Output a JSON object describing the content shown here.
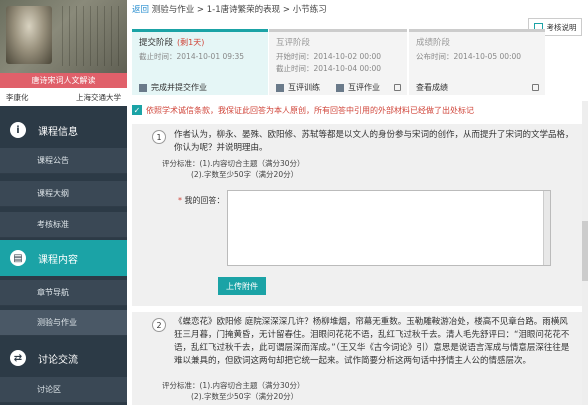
{
  "sidebar": {
    "course_title": "唐诗宋词人文解读",
    "teacher": "李康化",
    "university": "上海交通大学",
    "sections": [
      {
        "label": "课程信息",
        "icon": "info-icon"
      },
      {
        "label": "课程内容",
        "icon": "book-icon"
      },
      {
        "label": "讨论交流",
        "icon": "exchange-icon"
      }
    ],
    "items": [
      {
        "label": "课程公告"
      },
      {
        "label": "课程大纲"
      },
      {
        "label": "考核标准"
      },
      {
        "label": "章节导航"
      },
      {
        "label": "测验与作业"
      },
      {
        "label": "讨论区"
      }
    ]
  },
  "breadcrumb": {
    "back": "返回",
    "path": "测验与作业",
    "sep1": " >",
    "lesson": "1-1唐诗繁荣的表现",
    "sep2": " >",
    "current": "小节练习"
  },
  "guide": {
    "label": "考核说明",
    "icon": "document-icon"
  },
  "stages": [
    {
      "name": "提交阶段",
      "badge": "(剩1天)",
      "time1": "截止时间：2014-10-01 09:35",
      "time2": "",
      "action": "完成并提交作业"
    },
    {
      "name": "互评阶段",
      "badge": "",
      "time1": "开始时间：2014-10-02 00:00",
      "time2": "截止时间：2014-10-04 00:00",
      "action_a": "互评训练",
      "action_b": "互评作业"
    },
    {
      "name": "成绩阶段",
      "badge": "",
      "time1": "公布时间：2014-10-05 00:00",
      "time2": "",
      "action": "查看成绩"
    }
  ],
  "notice": "依照学术诚信条款，我保证此回答为本人原创，所有回答中引用的外部材料已经做了出处标记",
  "questions": [
    {
      "num": "1",
      "text": "作者认为，柳永、晏殊、欧阳修、苏轼等都是以文人的身份参与宋词的创作，从而提升了宋词的文学品格，你认为呢？并说明理由。",
      "criteria_label": "评分标准：",
      "criteria_1": "(1).内容切合主题（满分30分）",
      "criteria_2": "(2).字数至少50字（满分20分）",
      "answer_label": "我的回答：",
      "answer_star": "*",
      "upload": "上传附件"
    },
    {
      "num": "2",
      "text": "《蝶恋花》欧阳修 庭院深深深几许？杨柳堆烟，帘幕无重数。玉勒雕鞍游冶处，楼高不见章台路。雨横风狂三月暮，门掩黄昏，无计留春住。泪眼问花花不语，乱红飞过秋千去。清人毛先舒评曰：“泪眼问花花不语，乱红飞过秋千去，此可谓层深而浑成。”（王又华《古今词论》引）意思是说语言浑成与情意层深往往是难以兼具的，但欧词这两句却把它统一起来。试作简要分析这两句话中抒情主人公的情感层次。",
      "criteria_label": "评分标准：",
      "criteria_1": "(1).内容切合主题（满分30分）",
      "criteria_2": "(2).字数至少50字（满分20分）"
    }
  ]
}
